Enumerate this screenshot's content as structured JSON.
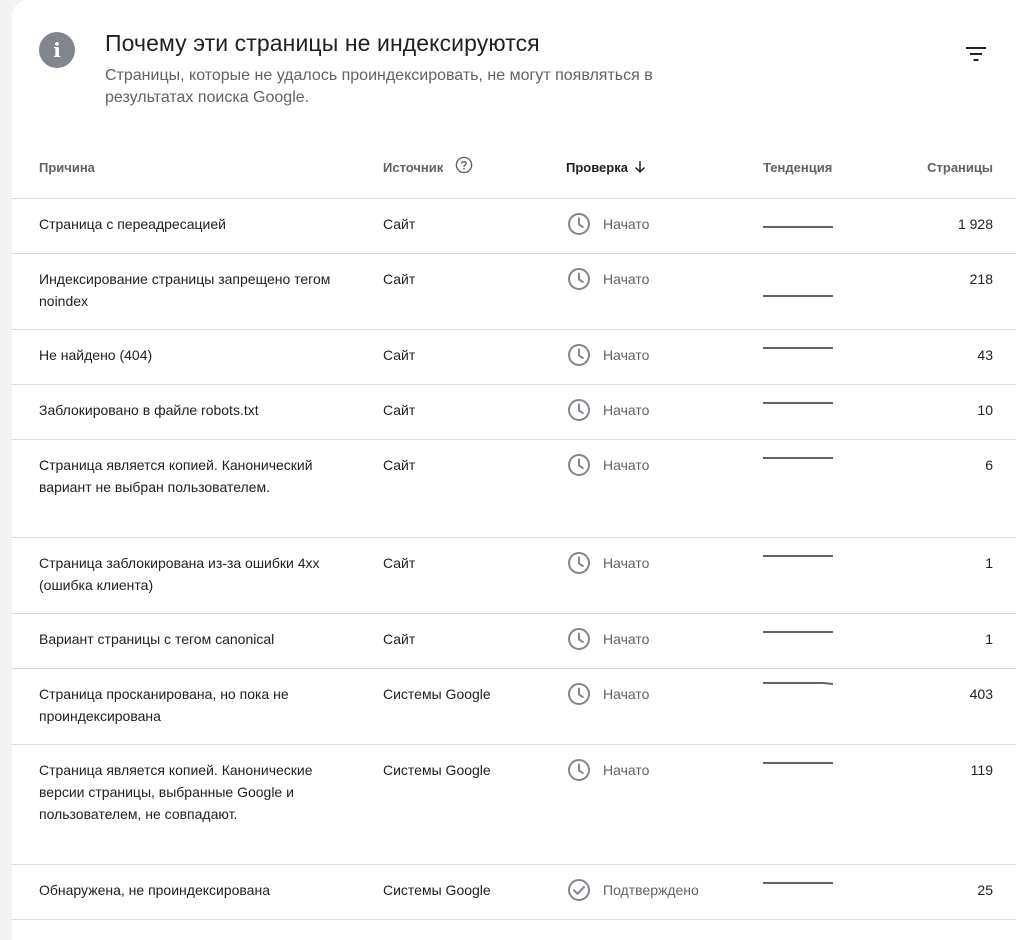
{
  "header": {
    "title": "Почему эти страницы не индексируются",
    "subtitle": "Страницы, которые не удалось проиндексировать, не могут появляться в результатах поиска Google.",
    "info_icon": "info-icon",
    "filter_icon": "filter-icon"
  },
  "columns": {
    "reason": "Причина",
    "source": "Источник",
    "check": "Проверка",
    "trend": "Тенденция",
    "pages": "Страницы"
  },
  "colors": {
    "text": "#202124",
    "muted": "#5f6368",
    "icon": "#80868b",
    "divider": "#dadce0",
    "trend_line": "#5f6368"
  },
  "rows": [
    {
      "reason": "Страница с переадресацией",
      "source": "Сайт",
      "status": "Начато",
      "status_icon": "clock-icon",
      "pages": "1 928"
    },
    {
      "reason": "Индексирование страницы запрещено тегом noindex",
      "source": "Сайт",
      "status": "Начато",
      "status_icon": "clock-icon",
      "pages": "218"
    },
    {
      "reason": "Не найдено (404)",
      "source": "Сайт",
      "status": "Начато",
      "status_icon": "clock-icon",
      "pages": "43"
    },
    {
      "reason": "Заблокировано в файле robots.txt",
      "source": "Сайт",
      "status": "Начато",
      "status_icon": "clock-icon",
      "pages": "10"
    },
    {
      "reason": "Страница является копией. Канонический вариант не выбран пользователем.",
      "source": "Сайт",
      "status": "Начато",
      "status_icon": "clock-icon",
      "pages": "6"
    },
    {
      "reason": "Страница заблокирована из-за ошибки 4xx (ошибка клиента)",
      "source": "Сайт",
      "status": "Начато",
      "status_icon": "clock-icon",
      "pages": "1"
    },
    {
      "reason": "Вариант страницы с тегом canonical",
      "source": "Сайт",
      "status": "Начато",
      "status_icon": "clock-icon",
      "pages": "1"
    },
    {
      "reason": "Страница просканирована, но пока не проиндексирована",
      "source": "Системы Google",
      "status": "Начато",
      "status_icon": "clock-icon",
      "pages": "403"
    },
    {
      "reason": "Страница является копией. Канонические версии страницы, выбранные Google и пользователем, не совпадают.",
      "source": "Системы Google",
      "status": "Начато",
      "status_icon": "clock-icon",
      "pages": "119"
    },
    {
      "reason": "Обнаружена, не проиндексирована",
      "source": "Системы Google",
      "status": "Подтверждено",
      "status_icon": "check-circle-icon",
      "pages": "25"
    }
  ]
}
